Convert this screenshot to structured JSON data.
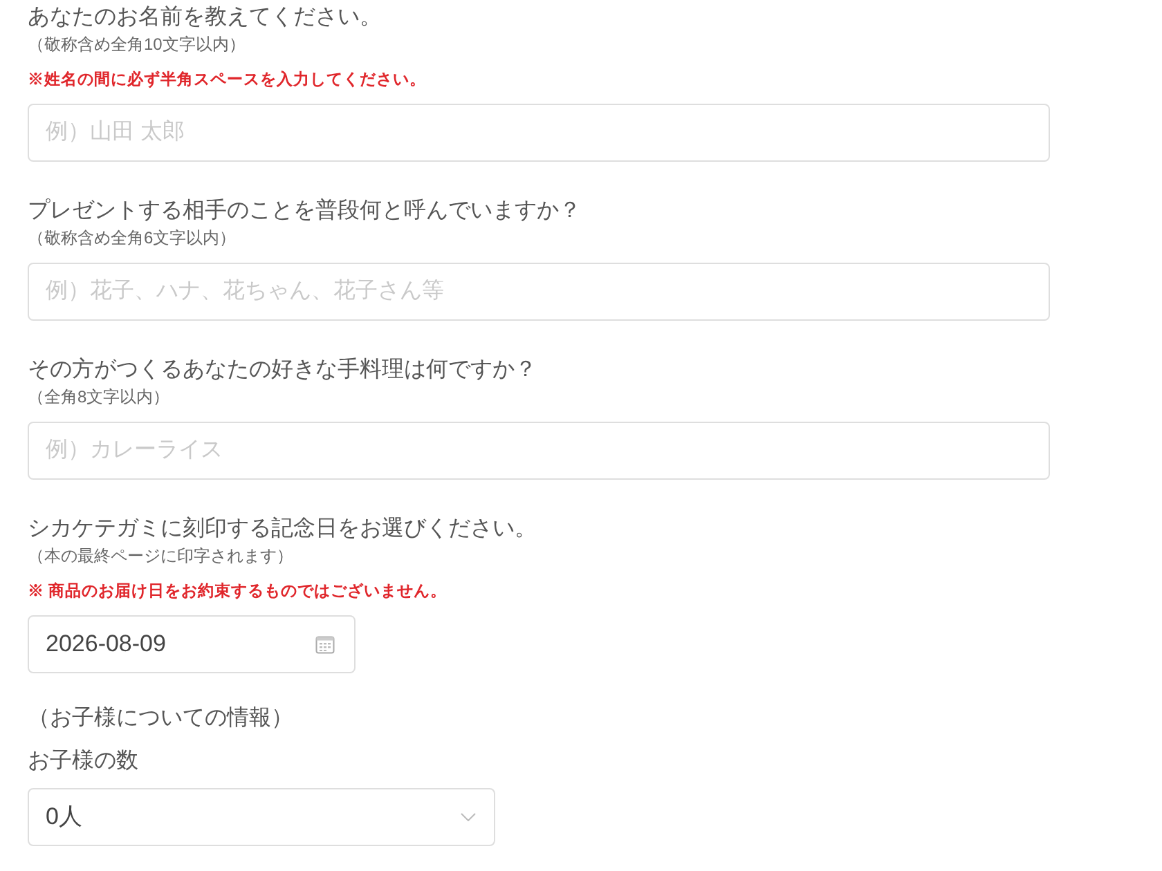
{
  "fields": [
    {
      "kind": "text",
      "label": "あなたのお名前を教えてください。",
      "note": "（敬称含め全角10文字以内）",
      "warning": "※姓名の間に必ず半角スペースを入力してください。",
      "placeholder": "例）山田 太郎"
    },
    {
      "kind": "text",
      "label": "プレゼントする相手のことを普段何と呼んでいますか？",
      "note": "（敬称含め全角6文字以内）",
      "placeholder": "例）花子、ハナ、花ちゃん、花子さん等"
    },
    {
      "kind": "text",
      "label": "その方がつくるあなたの好きな手料理は何ですか？",
      "note": "（全角8文字以内）",
      "placeholder": "例）カレーライス"
    },
    {
      "kind": "date",
      "label": "シカケテガミに刻印する記念日をお選びください。",
      "note": "（本の最終ページに印字されます）",
      "warning": "※ 商品のお届け日をお約束するものではございません。",
      "value": "2026-08-09"
    }
  ],
  "section": {
    "heading": "（お子様についての情報）",
    "fields": [
      {
        "kind": "select",
        "label": "お子様の数",
        "value": "0人"
      }
    ]
  }
}
